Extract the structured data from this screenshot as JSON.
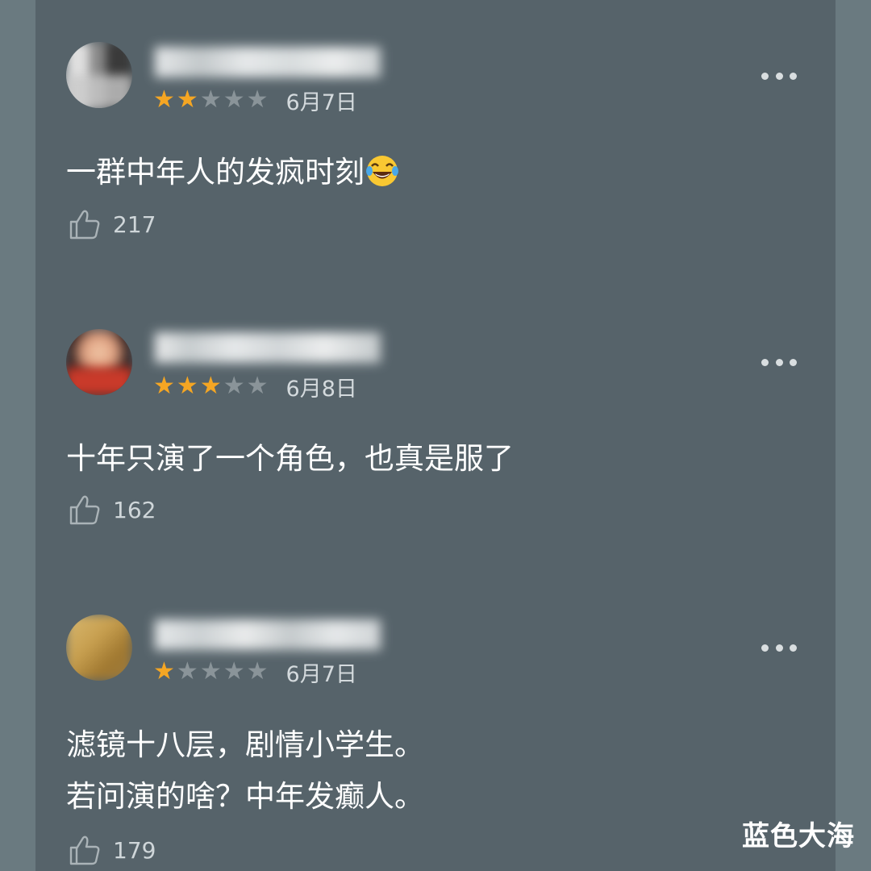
{
  "reviews": [
    {
      "rating": 2,
      "max_rating": 5,
      "date": "6月7日",
      "text_lines": [
        "一群中年人的发疯时刻"
      ],
      "emoji": "tears-of-joy-emoji",
      "likes": "217",
      "avatar_colors": [
        "#d8d8d8",
        "#8a8a8a",
        "#3a3a3a",
        "#c9c9c9"
      ]
    },
    {
      "rating": 3,
      "max_rating": 5,
      "date": "6月8日",
      "text_lines": [
        "十年只演了一个角色，也真是服了"
      ],
      "likes": "162",
      "avatar_colors": [
        "#f0c8a8",
        "#c93a2a",
        "#2a1a1a",
        "#e0a080"
      ]
    },
    {
      "rating": 1,
      "max_rating": 5,
      "date": "6月7日",
      "text_lines": [
        "滤镜十八层，剧情小学生。",
        "若问演的啥？中年发癫人。"
      ],
      "likes": "179",
      "avatar_colors": [
        "#c8a050",
        "#a07830",
        "#d8b870",
        "#9a7a40"
      ]
    }
  ],
  "colors": {
    "background": "#6a7a80",
    "panel": "#56636a",
    "star_on": "#f5a623",
    "star_off": "#8a9499",
    "text": "#ffffff",
    "meta": "#d4dadd"
  },
  "icons": [
    "thumbs-up-icon",
    "more-options-icon",
    "star-icon"
  ],
  "watermark": "蓝色大海"
}
